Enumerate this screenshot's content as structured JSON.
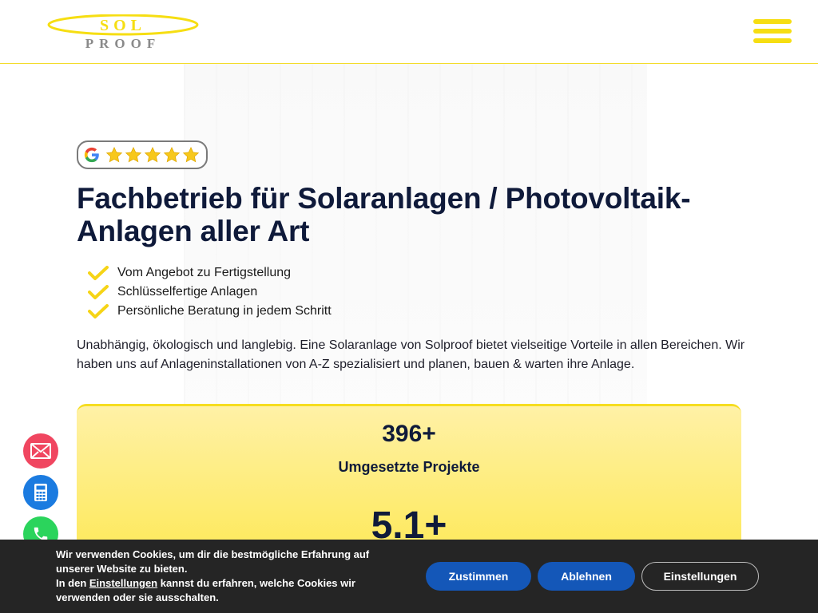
{
  "header": {
    "logo_top_text": "SOL",
    "logo_bottom_text": "PROOF",
    "menu_icon": "hamburger-icon"
  },
  "rating": {
    "provider_icon": "google-icon",
    "stars": 5,
    "max_stars": 5
  },
  "hero": {
    "title_line1": "Fachbetrieb für Solaranlagen / Photovoltaik-",
    "title_line2": "Anlagen aller Art",
    "features": [
      "Vom Angebot zu Fertigstellung",
      "Schlüsselfertige Anlagen",
      "Persönliche Beratung in jedem Schritt"
    ],
    "intro_line1": "Unabhängig, ökologisch und langlebig. Eine Solaranlage von Solproof bietet vielseitige Vorteile in allen Bereichen. Wir",
    "intro_line2": "haben uns auf Anlageninstallationen von A-Z spezialisiert und planen, bauen & warten ihre Anlage."
  },
  "stats": [
    {
      "value": "396+",
      "label": "Umgesetzte Projekte"
    },
    {
      "value": "5.1+",
      "label": ""
    }
  ],
  "floating_actions": [
    {
      "icon": "mail-icon",
      "color": "#f04660"
    },
    {
      "icon": "calculator-icon",
      "color": "#1b7be0"
    },
    {
      "icon": "phone-icon",
      "color": "#2bd45c"
    }
  ],
  "cookie_banner": {
    "line1": "Wir verwenden Cookies, um dir die bestmögliche Erfahrung auf",
    "line2": "unserer Website zu bieten.",
    "line3_prefix": "In den ",
    "line3_link": "Einstellungen",
    "line3_suffix": " kannst du erfahren, welche Cookies wir",
    "line4": "verwenden oder sie ausschalten.",
    "accept_label": "Zustimmen",
    "decline_label": "Ablehnen",
    "settings_label": "Einstellungen"
  },
  "colors": {
    "brand_yellow": "#f6de12",
    "navy_text": "#0f1a3a",
    "cookie_button_blue": "#1457b8",
    "cookie_bg": "#252525"
  }
}
